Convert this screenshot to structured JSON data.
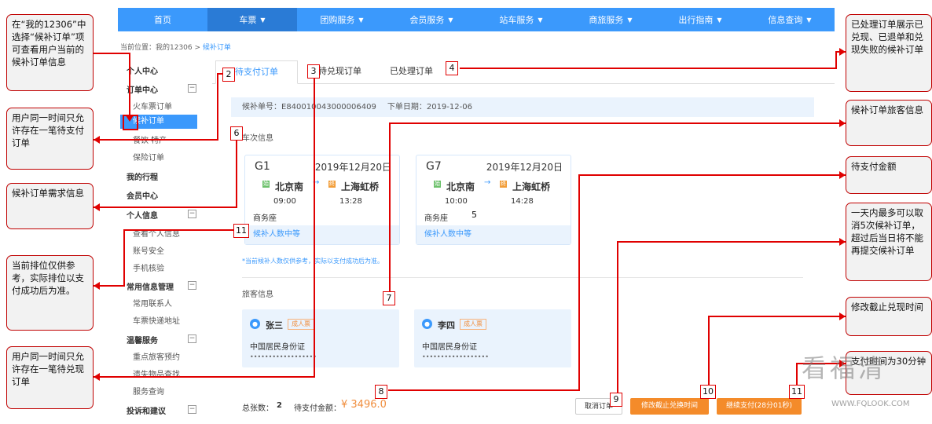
{
  "topnav": {
    "items": [
      {
        "label": "首页",
        "has_caret": false
      },
      {
        "label": "车票",
        "has_caret": true
      },
      {
        "label": "团购服务",
        "has_caret": true
      },
      {
        "label": "会员服务",
        "has_caret": true
      },
      {
        "label": "站车服务",
        "has_caret": true
      },
      {
        "label": "商旅服务",
        "has_caret": true
      },
      {
        "label": "出行指南",
        "has_caret": true
      },
      {
        "label": "信息查询",
        "has_caret": true
      }
    ],
    "active_index": 1
  },
  "breadcrumb": {
    "prefix": "当前位置：我的12306 > ",
    "current": "候补订单"
  },
  "sidebar": {
    "personal_center": "个人中心",
    "order_center": "订单中心",
    "train_ticket_orders": "火车票订单",
    "waitlist_orders": "候补订单",
    "meal_specialty": "餐饮·特产",
    "insurance_orders": "保险订单",
    "my_trips": "我的行程",
    "member_center": "会员中心",
    "personal_info": "个人信息",
    "view_personal_info": "查看个人信息",
    "account_security": "账号安全",
    "phone_verify": "手机核验",
    "common_info": "常用信息管理",
    "frequent_contacts": "常用联系人",
    "express_address": "车票快递地址",
    "warm_service": "温馨服务",
    "key_passenger": "重点旅客预约",
    "lost_items": "遗失物品查找",
    "service_query": "服务查询",
    "complaints": "投诉和建议",
    "collapse_symbol": "−"
  },
  "tabs": [
    "待支付订单",
    "待兑现订单",
    "已处理订单"
  ],
  "order": {
    "number_label": "候补单号：",
    "number": "E840010043000006409",
    "date_label": "下单日期：",
    "date": "2019-12-06"
  },
  "section_titles": {
    "trains": "车次信息",
    "passengers": "旅客信息"
  },
  "trains": [
    {
      "no": "G1",
      "date": "2019年12月20日",
      "from": "北京南",
      "to": "上海虹桥",
      "depart": "09:00",
      "arrive": "13:28",
      "seat": "商务座",
      "status": "候补人数中等"
    },
    {
      "no": "G7",
      "date": "2019年12月20日",
      "from": "北京南",
      "to": "上海虹桥",
      "depart": "10:00",
      "arrive": "14:28",
      "seat": "商务座",
      "status": "候补人数中等"
    }
  ],
  "station_icons": {
    "from": "始",
    "to": "终",
    "arrow": "→"
  },
  "note": "*当前候补人数仅供参考，实际以支付成功后为准。",
  "passengers": [
    {
      "name": "张三",
      "type": "成人票",
      "id_type": "中国居民身份证",
      "id_masked": "••••••••••••••••••"
    },
    {
      "name": "李四",
      "type": "成人票",
      "id_type": "中国居民身份证",
      "id_masked": "••••••••••••••••••"
    }
  ],
  "summary": {
    "count_label": "总张数：",
    "count": "2",
    "pay_label": "待支付金额：",
    "pay_amount": "¥ 3496.0"
  },
  "buttons": {
    "cancel": "取消订单",
    "modify": "修改截止兑换时间",
    "continue": "继续支付(28分01秒)"
  },
  "annotations": {
    "left": [
      "在“我的12306”中选择“候补订单”项可查看用户当前的候补订单信息",
      "用户同一时间只允许存在一笔待支付订单",
      "候补订单需求信息",
      "当前排位仅供参考，实际排位以支付成功后为准。",
      "用户同一时间只允许存在一笔待兑现订单"
    ],
    "right": [
      "已处理订单展示已兑现、已退单和兑现失败的候补订单",
      "候补订单旅客信息",
      "待支付金额",
      "一天内最多可以取消5次候补订单，超过后当日将不能再提交候补订单",
      "修改截止兑现时间",
      "支付时间为30分钟"
    ],
    "numbers": [
      "1",
      "2",
      "3",
      "4",
      "5",
      "6",
      "7",
      "8",
      "9",
      "10",
      "11",
      "11"
    ]
  },
  "colors": {
    "primary": "#3b99fc",
    "accent": "#f48b2a",
    "annotation": "#e00000"
  },
  "watermark": {
    "text": "看福清",
    "url": "WWW.FQLOOK.COM"
  }
}
